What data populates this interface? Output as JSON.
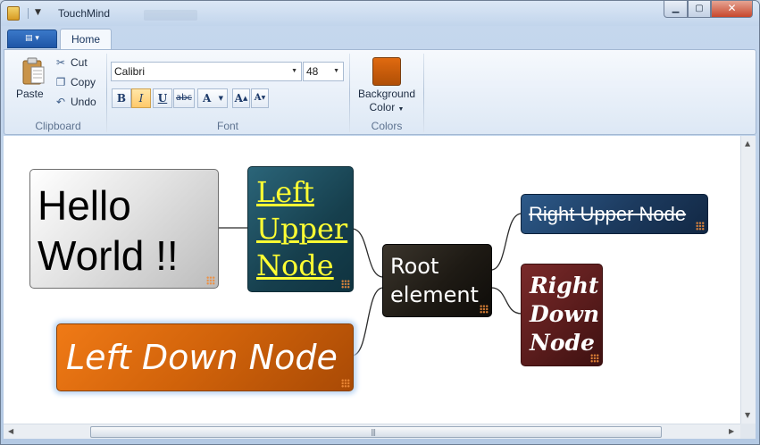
{
  "window": {
    "title": "TouchMind",
    "controls": {
      "minimize": "▁",
      "maximize": "▢",
      "close": "✕"
    }
  },
  "ribbon": {
    "file_button_icon": "menu-icon",
    "tabs": [
      {
        "label": "Home",
        "active": true
      }
    ],
    "clipboard": {
      "paste": "Paste",
      "cut": "Cut",
      "copy": "Copy",
      "undo": "Undo",
      "group_label": "Clipboard"
    },
    "font": {
      "family": "Calibri",
      "size": "48",
      "bold": "B",
      "italic": "I",
      "underline": "U",
      "strikethrough": "abc",
      "font_color": "A",
      "grow": "A",
      "shrink": "A",
      "italic_active": true,
      "group_label": "Font"
    },
    "colors": {
      "background_color": "Background",
      "background_color_line2": "Color",
      "swatch": "#e06a10",
      "group_label": "Colors"
    }
  },
  "mindmap": {
    "nodes": {
      "hello": {
        "text_line1": "Hello",
        "text_line2": "World !!",
        "fill": "#d8d8d8",
        "color": "#000000"
      },
      "left_upper": {
        "text_line1": "Left",
        "text_line2": "Upper",
        "text_line3": "Node",
        "fill": "#1c4a5a",
        "color": "#ffff33"
      },
      "left_down": {
        "text": "Left Down Node",
        "fill": "#d0620a",
        "color": "#ffffff"
      },
      "root": {
        "text_line1": "Root",
        "text_line2": "element",
        "fill": "#1e1a14",
        "color": "#ffffff"
      },
      "right_upper": {
        "text": "Right Upper Node",
        "fill": "#1c3a5e",
        "color": "#ffffff"
      },
      "right_down": {
        "text_line1": "Right",
        "text_line2": "Down",
        "text_line3": "Node",
        "fill": "#5a1c1c",
        "color": "#ffffff"
      }
    }
  },
  "scrollbar": {
    "grip": "|||"
  }
}
